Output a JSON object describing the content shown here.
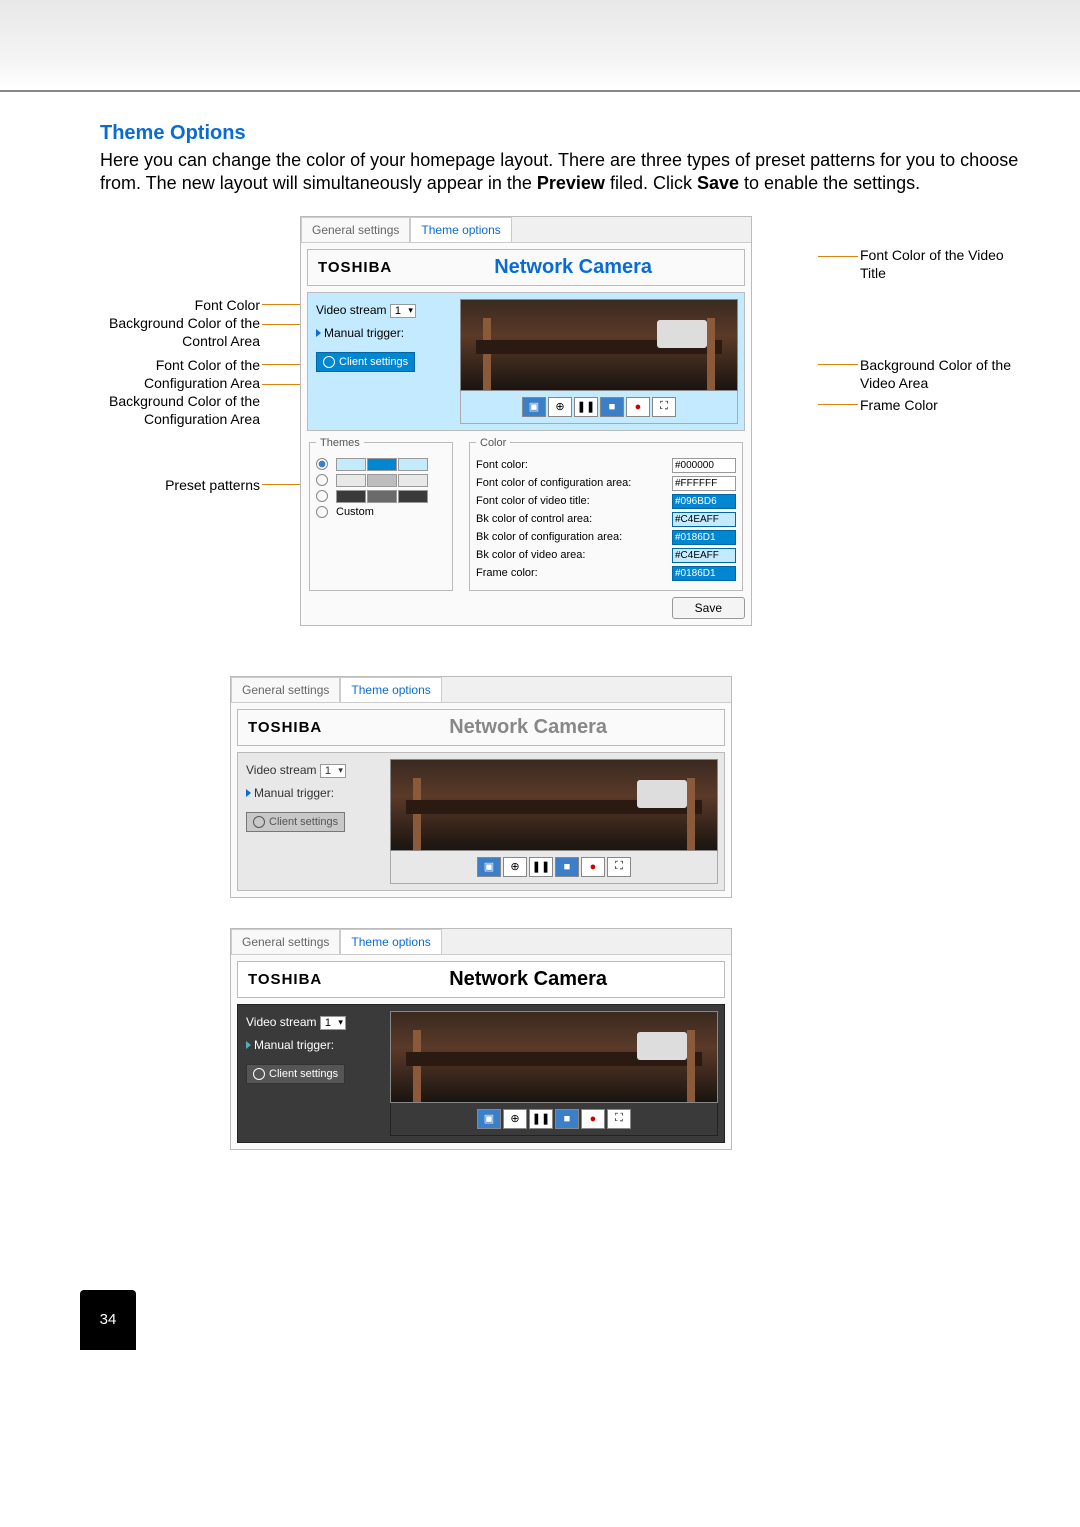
{
  "heading": "Theme Options",
  "intro_pre": "Here you can change the color of your homepage layout. There are three types of preset patterns for you to choose from. The new layout will simultaneously appear in the ",
  "intro_preview": "Preview",
  "intro_mid": " filed. Click ",
  "intro_save": "Save",
  "intro_post": " to enable the settings.",
  "callouts": {
    "font_color": "Font Color",
    "bk_control": "Background Color of the Control Area",
    "font_config": "Font Color of the Configuration Area",
    "bk_config": "Background Color of the Configuration Area",
    "preset": "Preset patterns",
    "font_video_title": "Font Color of the Video Title",
    "bk_video": "Background Color of the Video Area",
    "frame": "Frame Color"
  },
  "tabs": {
    "general": "General settings",
    "theme": "Theme options"
  },
  "brand": "TOSHIBA",
  "title": "Network Camera",
  "video_stream_label": "Video stream",
  "video_stream_value": "1",
  "manual_trigger": "Manual trigger:",
  "client_settings": "Client settings",
  "themes_legend": "Themes",
  "custom_label": "Custom",
  "color_legend": "Color",
  "color_rows": [
    {
      "label": "Font color:",
      "value": "#000000"
    },
    {
      "label": "Font color of configuration area:",
      "value": "#FFFFFF"
    },
    {
      "label": "Font color of video title:",
      "value": "#096BD6"
    },
    {
      "label": "Bk color of control area:",
      "value": "#C4EAFF"
    },
    {
      "label": "Bk color of configuration area:",
      "value": "#0186D1"
    },
    {
      "label": "Bk color of video area:",
      "value": "#C4EAFF"
    },
    {
      "label": "Frame color:",
      "value": "#0186D1"
    }
  ],
  "save_label": "Save",
  "toolbar_icons": [
    "camera",
    "zoom",
    "pause",
    "stop",
    "record",
    "expand"
  ],
  "theme_swatches": [
    {
      "selected": true,
      "colors": [
        "#C4EAFF",
        "#0186D1",
        "#C4EAFF"
      ]
    },
    {
      "selected": false,
      "colors": [
        "#e8e8e8",
        "#bdbdbd",
        "#e8e8e8"
      ]
    },
    {
      "selected": false,
      "colors": [
        "#3a3a3a",
        "#6a6a6a",
        "#3a3a3a"
      ]
    }
  ],
  "page_number": "34"
}
